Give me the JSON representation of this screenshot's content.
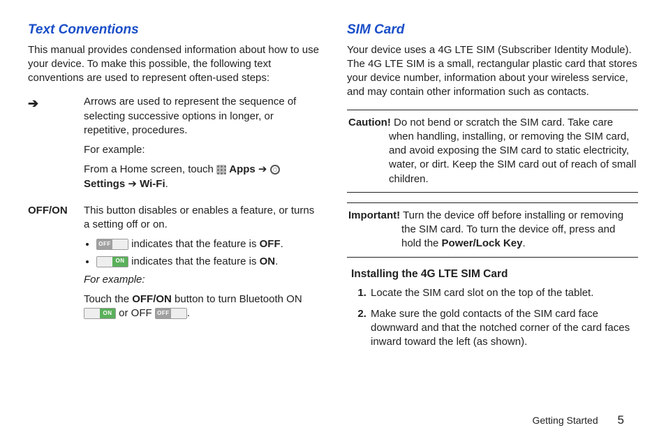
{
  "left": {
    "heading": "Text Conventions",
    "intro": "This manual provides condensed information about how to use your device. To make this possible, the following text conventions are used to represent often-used steps:",
    "arrow": {
      "desc": "Arrows are used to represent the sequence of selecting successive options in longer, or repetitive, procedures.",
      "example_label": "For example:",
      "example_prefix": "From a Home screen, touch ",
      "apps_label": "Apps",
      "settings_label": "Settings",
      "wifi_label": "Wi-Fi",
      "arrow_glyph": "➔"
    },
    "offon": {
      "label": "OFF/ON",
      "desc": "This button disables or enables a feature, or turns a setting off or on.",
      "off_bullet_mid": " indicates that the feature is ",
      "off_word": "OFF",
      "on_bullet_mid": " indicates that the feature is ",
      "on_word": "ON",
      "example_label": "For example:",
      "ex_pre": "Touch the ",
      "ex_bold": "OFF/ON",
      "ex_mid": " button to turn Bluetooth ON ",
      "ex_or": " or OFF ",
      "toggle_off_text": "OFF",
      "toggle_on_text": "ON"
    }
  },
  "right": {
    "heading": "SIM Card",
    "intro": "Your device uses a 4G LTE SIM (Subscriber Identity Module). The 4G LTE SIM is a small, rectangular plastic card that stores your device number, information about your wireless service, and may contain other information such as contacts.",
    "caution_label": "Caution!",
    "caution_text": " Do not bend or scratch the SIM card. Take care when handling, installing, or removing the SIM card, and avoid exposing the SIM card to static electricity, water, or dirt. Keep the SIM card out of reach of small children.",
    "important_label": "Important!",
    "important_text_pre": " Turn the device off before installing or removing the SIM card. To turn the device off, press and hold the ",
    "important_bold": "Power/Lock Key",
    "install_head": "Installing the 4G LTE SIM Card",
    "steps": [
      "Locate the SIM card slot on the top of the tablet.",
      "Make sure the gold contacts of the SIM card face downward and that the notched corner of the card faces inward toward the left (as shown)."
    ]
  },
  "footer": {
    "section": "Getting Started",
    "page": "5"
  }
}
